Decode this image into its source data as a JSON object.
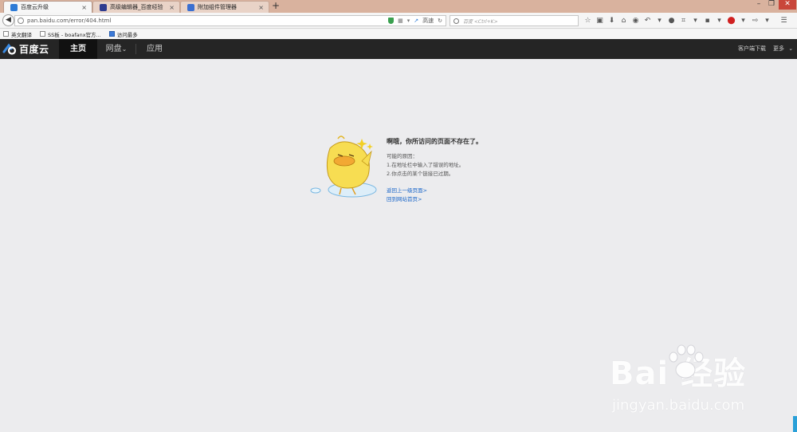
{
  "browser": {
    "tabs": [
      {
        "label": "百度云升级",
        "active": true
      },
      {
        "label": "高级编辑器_百度经验",
        "active": false
      },
      {
        "label": "附加组件管理器",
        "active": false
      }
    ],
    "new_tab": "+",
    "url": "pan.baidu.com/error/404.html",
    "speed_label": "高速",
    "search_placeholder": "百度 <Ctrl+K>"
  },
  "bookmarks": [
    {
      "label": "英文翻译"
    },
    {
      "label": "SS板 - boafanx官方..."
    },
    {
      "label": "访问最多"
    }
  ],
  "app": {
    "logo_text": "百度云",
    "nav": [
      {
        "label": "主页",
        "active": true
      },
      {
        "label": "网盘"
      },
      {
        "label": "应用"
      }
    ],
    "chevron": "⌄",
    "client_download": "客户端下载",
    "more": "更多"
  },
  "error": {
    "title": "啊哦，你所访问的页面不存在了。",
    "reasons_heading": "可能的原因：",
    "reason_1": "1.在地址栏中输入了错误的地址。",
    "reason_2": "2.你点击的某个链接已过期。",
    "back_link": "返回上一级页面>",
    "home_link": "回到网站首页>"
  },
  "watermark": {
    "main": "Bai  经验",
    "sub": "jingyan.baidu.com"
  },
  "colors": {
    "accent_link": "#1a66c9",
    "app_header": "#252525",
    "page_bg": "#ececee"
  }
}
